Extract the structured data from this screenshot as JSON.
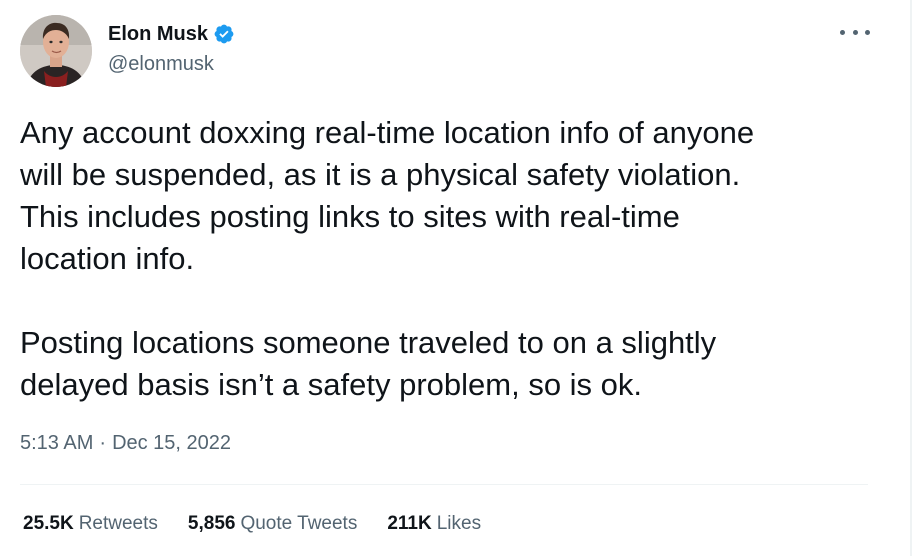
{
  "author": {
    "name": "Elon Musk",
    "handle": "@elonmusk",
    "verified": true
  },
  "icons": {
    "verified": "verified-badge-icon",
    "more": "more-horizontal-icon"
  },
  "tweet": {
    "paragraph1": "Any account doxxing real-time location info of anyone\nwill be suspended, as it is a physical safety violation.\nThis includes posting links to sites with real-time\nlocation info.",
    "paragraph2": "Posting locations someone traveled to on a slightly\ndelayed basis isn’t a safety problem, so is ok.",
    "time": "5:13 AM",
    "separator": "·",
    "date": "Dec 15, 2022"
  },
  "stats": {
    "retweets_count": "25.5K",
    "retweets_label": "Retweets",
    "quotes_count": "5,856",
    "quotes_label": "Quote Tweets",
    "likes_count": "211K",
    "likes_label": "Likes"
  },
  "colors": {
    "text": "#0f1419",
    "secondary": "#536471",
    "verified": "#1d9bf0",
    "divider": "#eff3f4"
  }
}
